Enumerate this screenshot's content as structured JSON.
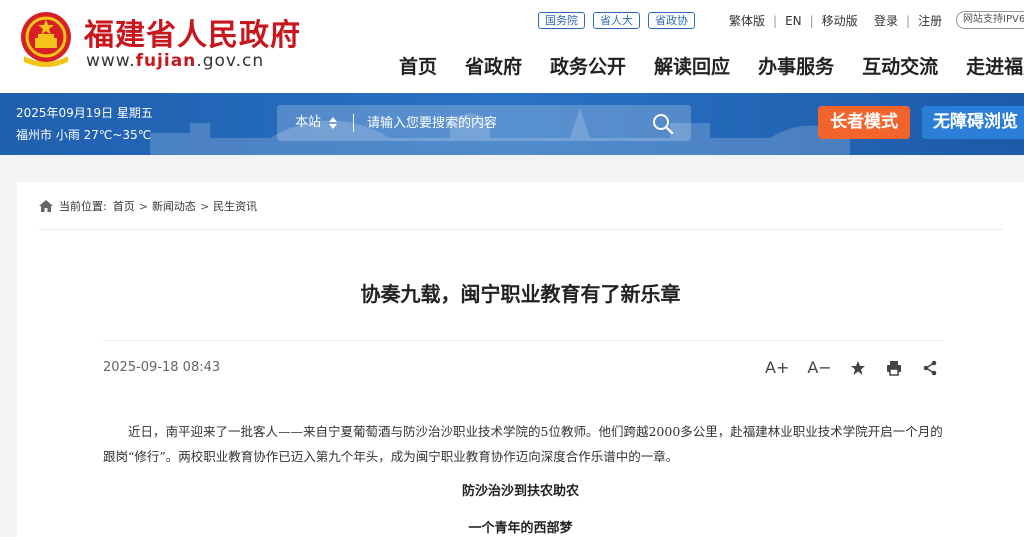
{
  "header": {
    "site_name": "福建省人民政府",
    "site_url_prefix": "www.",
    "site_url_domain": "fujian",
    "site_url_suffix": ".gov.cn",
    "pill_links": [
      "国务院",
      "省人大",
      "省政协"
    ],
    "lang_links": [
      "繁体版",
      "EN",
      "移动版"
    ],
    "login": "登录",
    "register": "注册",
    "ipv6": "网站支持IPV6",
    "nav": [
      "首页",
      "省政府",
      "政务公开",
      "解读回应",
      "办事服务",
      "互动交流",
      "走进福建"
    ],
    "brand_color": "#c8161d"
  },
  "banner": {
    "date": "2025年09月19日 星期五",
    "weather": "福州市 小雨 27℃~35℃",
    "search_scope": "本站",
    "search_placeholder": "请输入您要搜索的内容",
    "elder_mode": "长者模式",
    "accessible": "无障碍浏览",
    "bg_color": "#2a72c4",
    "elder_color": "#f2642c"
  },
  "breadcrumb": {
    "label": "当前位置:",
    "items": [
      "首页",
      "新闻动态",
      "民生资讯"
    ]
  },
  "article": {
    "title": "协奏九载，闽宁职业教育有了新乐章",
    "date": "2025-09-18 08:43",
    "tools": [
      "A+",
      "A−"
    ],
    "paragraph_1": "近日，南平迎来了一批客人——来自宁夏葡萄酒与防沙治沙职业技术学院的5位教师。他们跨越2000多公里，赴福建林业职业技术学院开启一个月的跟岗“修行”。两校职业教育协作已迈入第九个年头，成为闽宁职业教育协作迈向深度合作乐谱中的一章。",
    "subhead_1": "防沙治沙到扶农助农",
    "subhead_2": "一个青年的西部梦"
  }
}
